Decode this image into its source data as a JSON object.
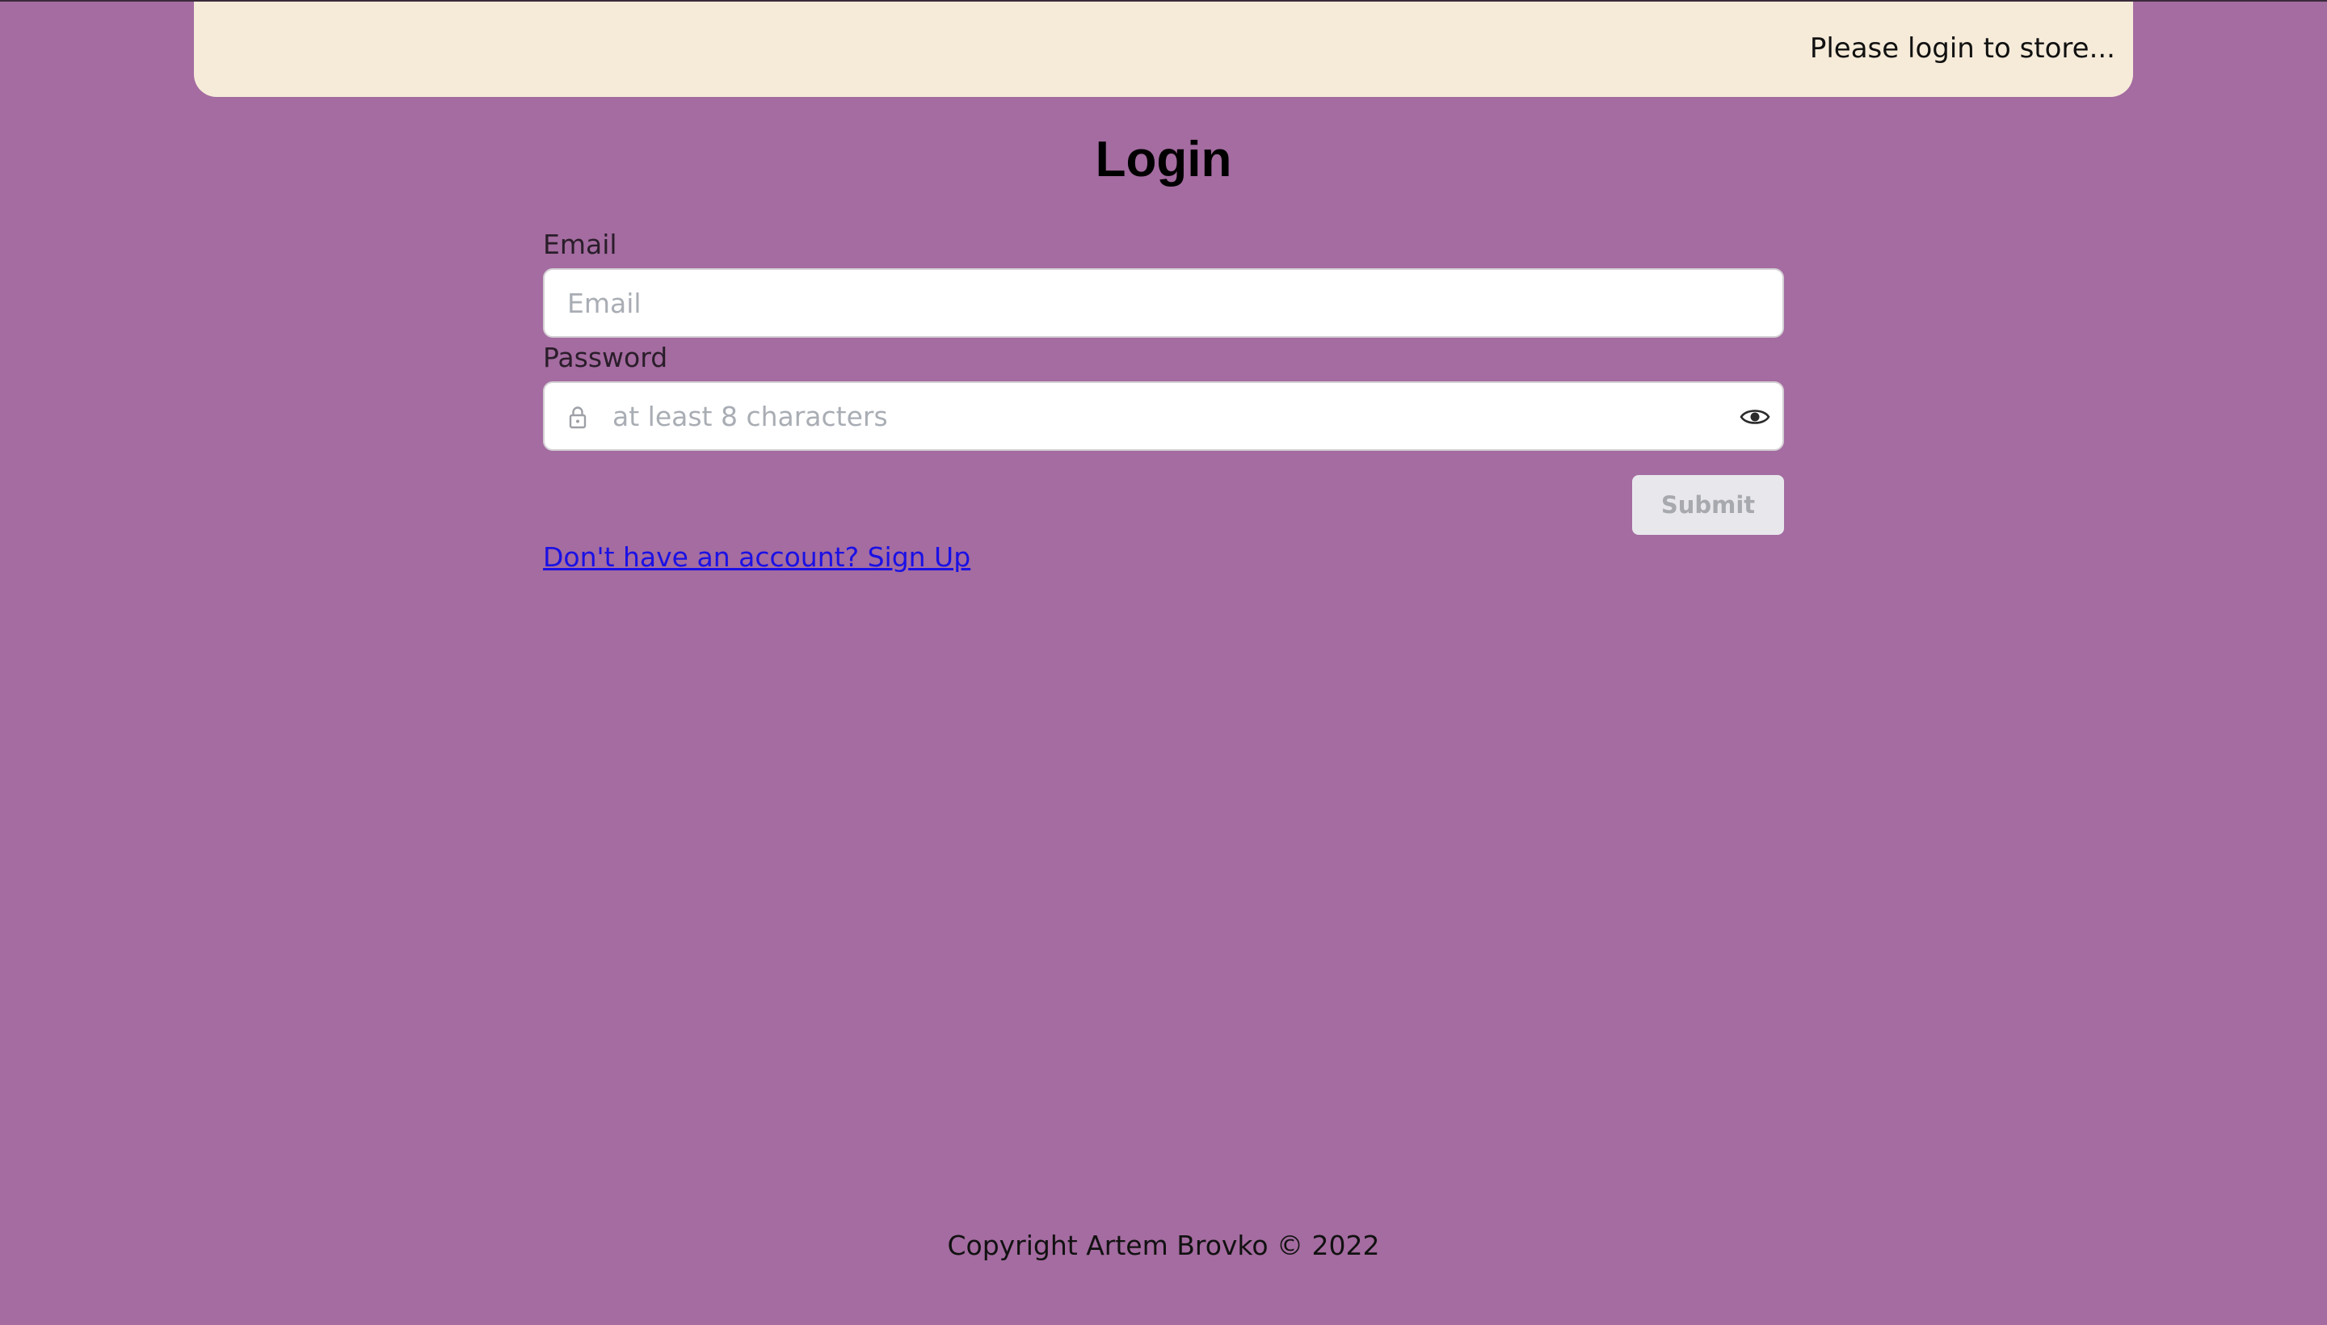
{
  "header": {
    "message": "Please login to store..."
  },
  "page": {
    "title": "Login"
  },
  "form": {
    "email": {
      "label": "Email",
      "placeholder": "Email",
      "value": ""
    },
    "password": {
      "label": "Password",
      "placeholder": "at least 8 characters",
      "value": "",
      "leading_icon": "lock-icon",
      "trailing_icon": "eye-icon"
    },
    "submit_label": "Submit",
    "signup_link": "Don't have an account? Sign Up"
  },
  "footer": {
    "copyright": "Copyright Artem Brovko © 2022"
  },
  "colors": {
    "background": "#a46ca0",
    "header_bg": "#f6ebd9",
    "link": "#1a10e6",
    "submit_bg": "#e8e8ec",
    "submit_text": "#a7a9ae"
  }
}
